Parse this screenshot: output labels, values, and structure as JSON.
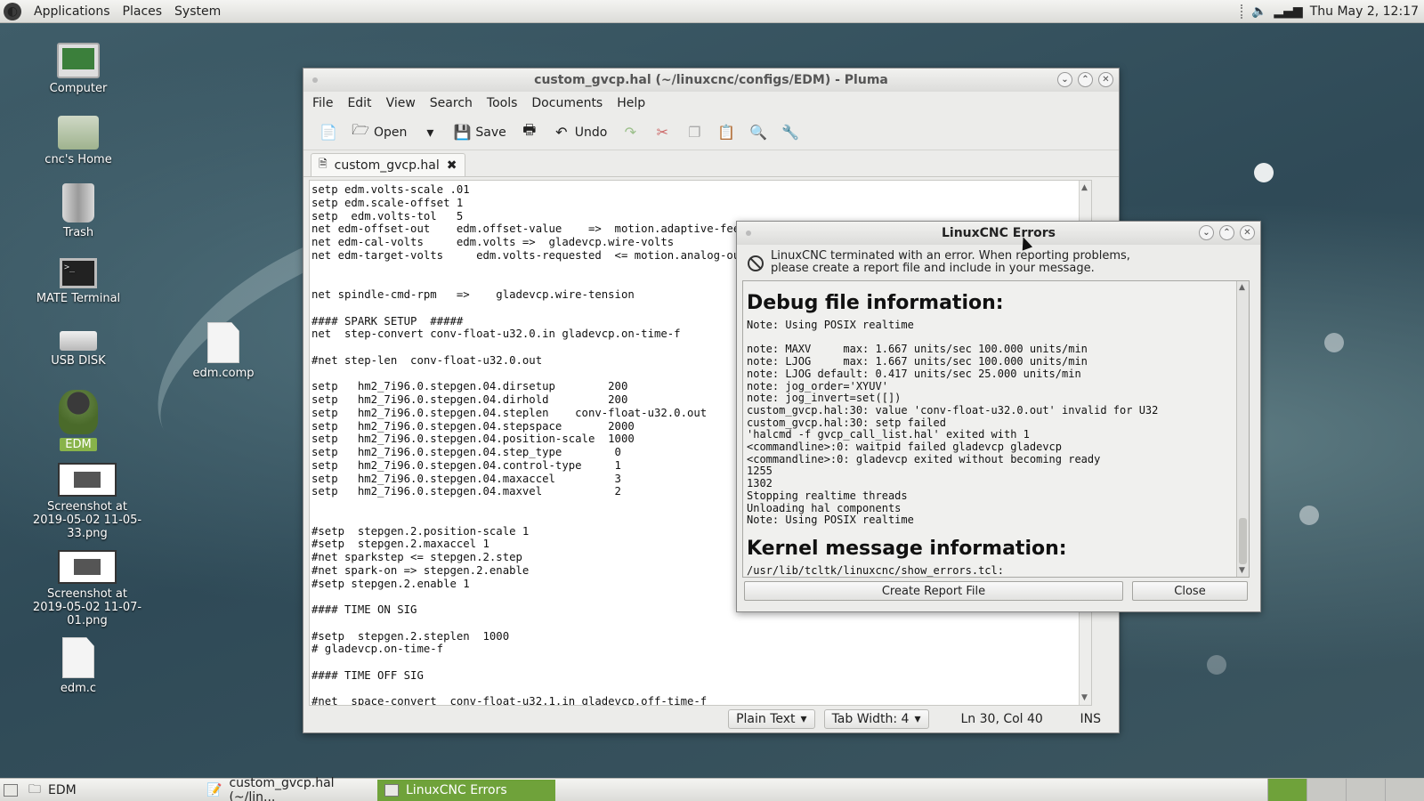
{
  "top_panel": {
    "menus": [
      "Applications",
      "Places",
      "System"
    ],
    "clock": "Thu May  2, 12:17"
  },
  "desktop": {
    "icons": [
      {
        "label": "Computer",
        "icon": "computer-icon"
      },
      {
        "label": "cnc's Home",
        "icon": "home-folder-icon"
      },
      {
        "label": "Trash",
        "icon": "trash-icon"
      },
      {
        "label": "MATE Terminal",
        "icon": "terminal-icon"
      },
      {
        "label": "USB DISK",
        "icon": "usb-drive-icon"
      },
      {
        "label": "EDM",
        "icon": "linuxcnc-penguin-icon"
      },
      {
        "label": "Screenshot at 2019-05-02 11-05-33.png",
        "icon": "image-file-icon"
      },
      {
        "label": "Screenshot at 2019-05-02 11-07-01.png",
        "icon": "image-file-icon"
      },
      {
        "label": "edm.c",
        "icon": "text-file-icon"
      },
      {
        "label": "edm.comp",
        "icon": "text-file-icon"
      }
    ]
  },
  "pluma": {
    "title": "custom_gvcp.hal (~/linuxcnc/configs/EDM) - Pluma",
    "menu": [
      "File",
      "Edit",
      "View",
      "Search",
      "Tools",
      "Documents",
      "Help"
    ],
    "toolbar": {
      "open": "Open",
      "save": "Save",
      "undo": "Undo"
    },
    "tab_label": "custom_gvcp.hal",
    "code": "setp edm.volts-scale .01\nsetp edm.scale-offset 1\nsetp  edm.volts-tol   5\nnet edm-offset-out    edm.offset-value    =>  motion.adaptive-feed\nnet edm-cal-volts     edm.volts =>  gladevcp.wire-volts\nnet edm-target-volts     edm.volts-requested  <= motion.analog-out-00\n\n\nnet spindle-cmd-rpm   =>    gladevcp.wire-tension\n\n#### SPARK SETUP  #####\nnet  step-convert conv-float-u32.0.in gladevcp.on-time-f\n\n#net step-len  conv-float-u32.0.out\n\nsetp   hm2_7i96.0.stepgen.04.dirsetup        200\nsetp   hm2_7i96.0.stepgen.04.dirhold         200\nsetp   hm2_7i96.0.stepgen.04.steplen    conv-float-u32.0.out\nsetp   hm2_7i96.0.stepgen.04.stepspace       2000\nsetp   hm2_7i96.0.stepgen.04.position-scale  1000\nsetp   hm2_7i96.0.stepgen.04.step_type        0\nsetp   hm2_7i96.0.stepgen.04.control-type     1\nsetp   hm2_7i96.0.stepgen.04.maxaccel         3\nsetp   hm2_7i96.0.stepgen.04.maxvel           2\n\n\n#setp  stepgen.2.position-scale 1\n#setp  stepgen.2.maxaccel 1\n#net sparkstep <= stepgen.2.step\n#net spark-on => stepgen.2.enable\n#setp stepgen.2.enable 1\n\n#### TIME ON SIG\n\n#setp  stepgen.2.steplen  1000\n# gladevcp.on-time-f\n\n#### TIME OFF SIG\n\n#net  space-convert  conv-float-u32.1.in gladevcp.off-time-f",
    "status": {
      "language": "Plain Text",
      "tab_width": "Tab Width:  4",
      "position": "Ln 30, Col 40",
      "mode": "INS"
    }
  },
  "error_dialog": {
    "title": "LinuxCNC Errors",
    "message": "LinuxCNC terminated with an error.  When reporting problems,\nplease create a report file and include in your message.",
    "debug_heading": "Debug file information:",
    "debug_log": "Note: Using POSIX realtime\n\nnote: MAXV     max: 1.667 units/sec 100.000 units/min\nnote: LJOG     max: 1.667 units/sec 100.000 units/min\nnote: LJOG default: 0.417 units/sec 25.000 units/min\nnote: jog_order='XYUV'\nnote: jog_invert=set([])\ncustom_gvcp.hal:30: value 'conv-float-u32.0.out' invalid for U32\ncustom_gvcp.hal:30: setp failed\n'halcmd -f gvcp_call_list.hal' exited with 1\n<commandline>:0: waitpid failed gladevcp gladevcp\n<commandline>:0: gladevcp exited without becoming ready\n1255\n1302\nStopping realtime threads\nUnloading hal components\nNote: Using POSIX realtime",
    "kernel_heading": "Kernel message information:",
    "kernel_log": "/usr/lib/tcltk/linuxcnc/show_errors.tcl:",
    "buttons": {
      "report": "Create Report File",
      "close": "Close"
    }
  },
  "bottom_panel": {
    "tasks": [
      "EDM",
      "custom_gvcp.hal (~/lin...",
      "LinuxCNC Errors"
    ]
  }
}
